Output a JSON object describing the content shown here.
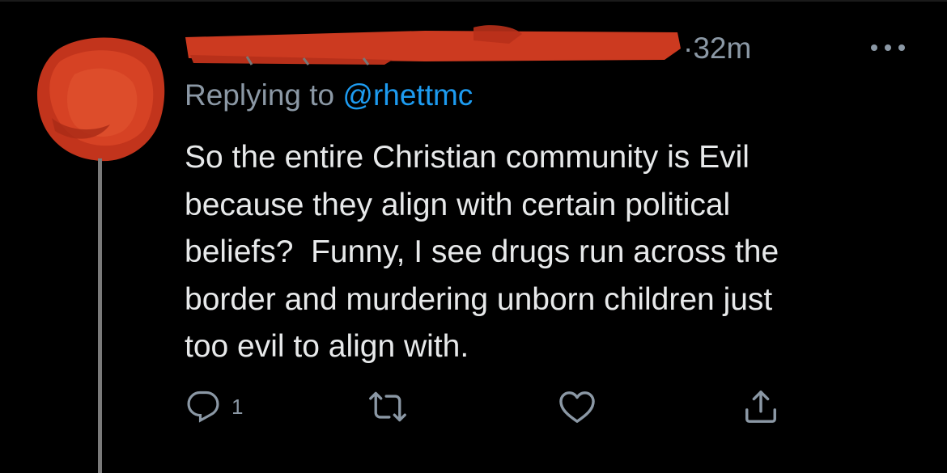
{
  "tweet": {
    "timestamp": "32m",
    "replying_label": "Replying to ",
    "replying_handle": "@rhettmc",
    "text_lines": [
      "So the entire Christian community is Evil",
      "because they align with certain political",
      "beliefs?  Funny, I see drugs run across the",
      "border and murdering unborn children just",
      "too evil to align with."
    ]
  },
  "actions": {
    "reply_count": "1"
  },
  "icons": {
    "more": "more-horizontal-icon",
    "reply": "reply-icon",
    "retweet": "retweet-icon",
    "like": "heart-icon",
    "share": "share-icon"
  },
  "colors": {
    "background": "#000000",
    "text": "#e7e9ea",
    "secondary": "#8b98a5",
    "link": "#1d9bf0",
    "redaction": "#cc3a20"
  }
}
